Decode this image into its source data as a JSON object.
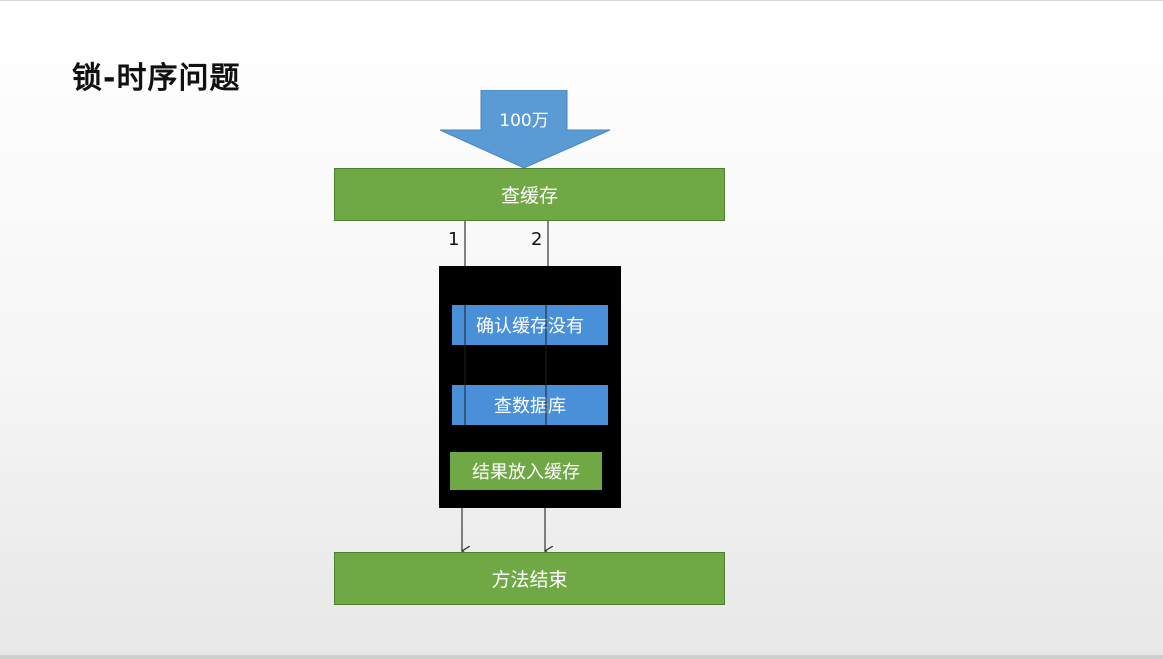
{
  "slide": {
    "title": "锁-时序问题"
  },
  "diagram": {
    "input_arrow_label": "100万",
    "query_cache": "查缓存",
    "thread_labels": [
      "1",
      "2"
    ],
    "locked_steps": [
      "确认缓存没有",
      "查数据库",
      "结果放入缓存"
    ],
    "method_end": "方法结束"
  },
  "colors": {
    "green": "#70a845",
    "blue": "#4a90d9",
    "lock_block": "#000000",
    "arrow_blue": "#5b9bd5"
  }
}
